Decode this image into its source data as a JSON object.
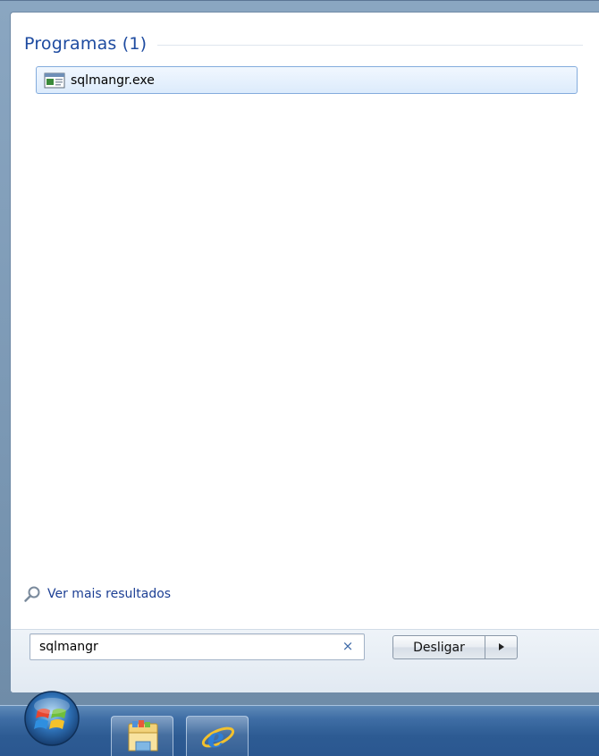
{
  "start_menu": {
    "section": {
      "title": "Programas (1)"
    },
    "results": [
      {
        "label": "sqlmangr.exe",
        "icon": "application-window-icon"
      }
    ],
    "more_results_label": "Ver mais resultados",
    "search": {
      "value": "sqlmangr",
      "clear_glyph": "×"
    },
    "shutdown": {
      "label": "Desligar",
      "arrow_icon": "triangle-right-icon"
    }
  },
  "taskbar": {
    "start_button_icon": "windows-logo-icon",
    "pinned": [
      {
        "icon": "folder-library-icon"
      },
      {
        "icon": "internet-explorer-icon"
      }
    ]
  },
  "colors": {
    "section_title": "#1e4ba0",
    "link": "#1c3f94",
    "result_highlight": "#dcebfc",
    "taskbar": "#2d5b93"
  }
}
